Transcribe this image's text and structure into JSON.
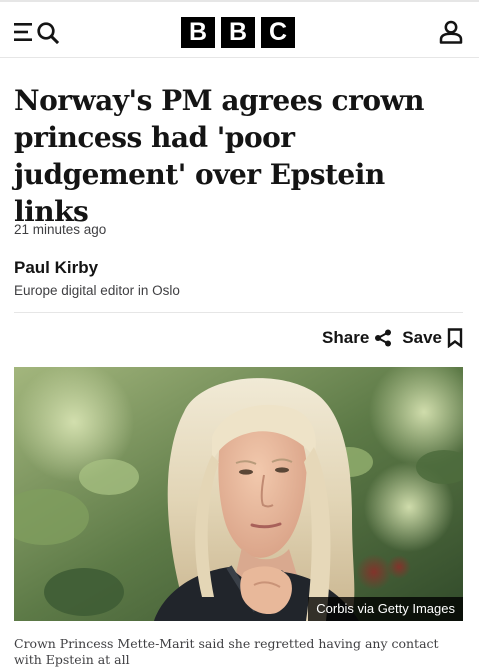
{
  "header": {
    "logo_letters": [
      "B",
      "B",
      "C"
    ],
    "menu_icon": "menu-icon",
    "search_icon": "search-icon",
    "account_icon": "account-icon"
  },
  "article": {
    "headline": "Norway's PM agrees crown princess had 'poor judgement' over Epstein links",
    "timestamp": "21 minutes ago",
    "author": {
      "name": "Paul Kirby",
      "role": "Europe digital editor in Oslo"
    },
    "actions": {
      "share_label": "Share",
      "save_label": "Save"
    },
    "image": {
      "credit": "Corbis via Getty Images",
      "caption": "Crown Princess Mette-Marit said she regretted having any contact with Epstein at all"
    }
  },
  "colors": {
    "text": "#141414",
    "muted": "#3f3f42",
    "divider": "#e6e6e6",
    "logo": "#000000"
  }
}
